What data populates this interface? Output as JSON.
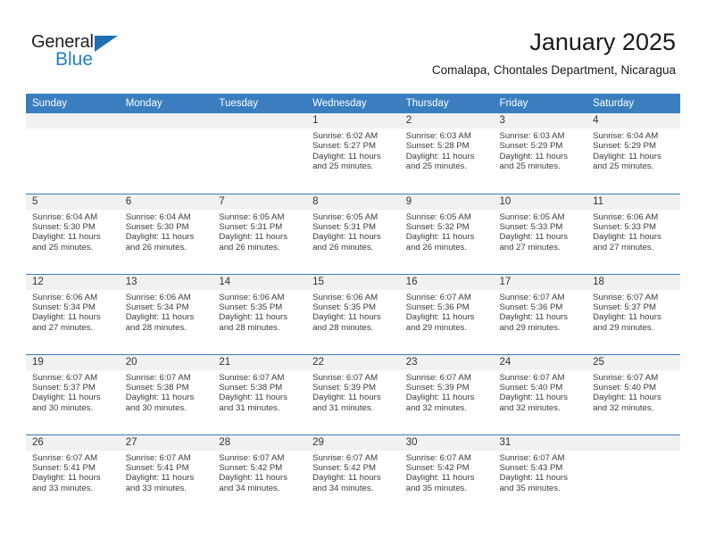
{
  "brand": {
    "name_top": "General",
    "name_bottom": "Blue",
    "triangle_icon": "triangle-icon",
    "color_dark": "#231f20",
    "color_blue": "#1f7fcf"
  },
  "header": {
    "title": "January 2025",
    "subtitle": "Comalapa, Chontales Department, Nicaragua"
  },
  "colors": {
    "header_blue": "#3a7ebf",
    "daynum_band": "#f1f1f1",
    "text": "#3c3c3c"
  },
  "calendar": {
    "weekday_headers": [
      "Sunday",
      "Monday",
      "Tuesday",
      "Wednesday",
      "Thursday",
      "Friday",
      "Saturday"
    ],
    "weeks": [
      [
        {
          "day": "",
          "lines": []
        },
        {
          "day": "",
          "lines": []
        },
        {
          "day": "",
          "lines": []
        },
        {
          "day": "1",
          "lines": [
            "Sunrise: 6:02 AM",
            "Sunset: 5:27 PM",
            "Daylight: 11 hours and 25 minutes."
          ]
        },
        {
          "day": "2",
          "lines": [
            "Sunrise: 6:03 AM",
            "Sunset: 5:28 PM",
            "Daylight: 11 hours and 25 minutes."
          ]
        },
        {
          "day": "3",
          "lines": [
            "Sunrise: 6:03 AM",
            "Sunset: 5:29 PM",
            "Daylight: 11 hours and 25 minutes."
          ]
        },
        {
          "day": "4",
          "lines": [
            "Sunrise: 6:04 AM",
            "Sunset: 5:29 PM",
            "Daylight: 11 hours and 25 minutes."
          ]
        }
      ],
      [
        {
          "day": "5",
          "lines": [
            "Sunrise: 6:04 AM",
            "Sunset: 5:30 PM",
            "Daylight: 11 hours and 25 minutes."
          ]
        },
        {
          "day": "6",
          "lines": [
            "Sunrise: 6:04 AM",
            "Sunset: 5:30 PM",
            "Daylight: 11 hours and 26 minutes."
          ]
        },
        {
          "day": "7",
          "lines": [
            "Sunrise: 6:05 AM",
            "Sunset: 5:31 PM",
            "Daylight: 11 hours and 26 minutes."
          ]
        },
        {
          "day": "8",
          "lines": [
            "Sunrise: 6:05 AM",
            "Sunset: 5:31 PM",
            "Daylight: 11 hours and 26 minutes."
          ]
        },
        {
          "day": "9",
          "lines": [
            "Sunrise: 6:05 AM",
            "Sunset: 5:32 PM",
            "Daylight: 11 hours and 26 minutes."
          ]
        },
        {
          "day": "10",
          "lines": [
            "Sunrise: 6:05 AM",
            "Sunset: 5:33 PM",
            "Daylight: 11 hours and 27 minutes."
          ]
        },
        {
          "day": "11",
          "lines": [
            "Sunrise: 6:06 AM",
            "Sunset: 5:33 PM",
            "Daylight: 11 hours and 27 minutes."
          ]
        }
      ],
      [
        {
          "day": "12",
          "lines": [
            "Sunrise: 6:06 AM",
            "Sunset: 5:34 PM",
            "Daylight: 11 hours and 27 minutes."
          ]
        },
        {
          "day": "13",
          "lines": [
            "Sunrise: 6:06 AM",
            "Sunset: 5:34 PM",
            "Daylight: 11 hours and 28 minutes."
          ]
        },
        {
          "day": "14",
          "lines": [
            "Sunrise: 6:06 AM",
            "Sunset: 5:35 PM",
            "Daylight: 11 hours and 28 minutes."
          ]
        },
        {
          "day": "15",
          "lines": [
            "Sunrise: 6:06 AM",
            "Sunset: 5:35 PM",
            "Daylight: 11 hours and 28 minutes."
          ]
        },
        {
          "day": "16",
          "lines": [
            "Sunrise: 6:07 AM",
            "Sunset: 5:36 PM",
            "Daylight: 11 hours and 29 minutes."
          ]
        },
        {
          "day": "17",
          "lines": [
            "Sunrise: 6:07 AM",
            "Sunset: 5:36 PM",
            "Daylight: 11 hours and 29 minutes."
          ]
        },
        {
          "day": "18",
          "lines": [
            "Sunrise: 6:07 AM",
            "Sunset: 5:37 PM",
            "Daylight: 11 hours and 29 minutes."
          ]
        }
      ],
      [
        {
          "day": "19",
          "lines": [
            "Sunrise: 6:07 AM",
            "Sunset: 5:37 PM",
            "Daylight: 11 hours and 30 minutes."
          ]
        },
        {
          "day": "20",
          "lines": [
            "Sunrise: 6:07 AM",
            "Sunset: 5:38 PM",
            "Daylight: 11 hours and 30 minutes."
          ]
        },
        {
          "day": "21",
          "lines": [
            "Sunrise: 6:07 AM",
            "Sunset: 5:38 PM",
            "Daylight: 11 hours and 31 minutes."
          ]
        },
        {
          "day": "22",
          "lines": [
            "Sunrise: 6:07 AM",
            "Sunset: 5:39 PM",
            "Daylight: 11 hours and 31 minutes."
          ]
        },
        {
          "day": "23",
          "lines": [
            "Sunrise: 6:07 AM",
            "Sunset: 5:39 PM",
            "Daylight: 11 hours and 32 minutes."
          ]
        },
        {
          "day": "24",
          "lines": [
            "Sunrise: 6:07 AM",
            "Sunset: 5:40 PM",
            "Daylight: 11 hours and 32 minutes."
          ]
        },
        {
          "day": "25",
          "lines": [
            "Sunrise: 6:07 AM",
            "Sunset: 5:40 PM",
            "Daylight: 11 hours and 32 minutes."
          ]
        }
      ],
      [
        {
          "day": "26",
          "lines": [
            "Sunrise: 6:07 AM",
            "Sunset: 5:41 PM",
            "Daylight: 11 hours and 33 minutes."
          ]
        },
        {
          "day": "27",
          "lines": [
            "Sunrise: 6:07 AM",
            "Sunset: 5:41 PM",
            "Daylight: 11 hours and 33 minutes."
          ]
        },
        {
          "day": "28",
          "lines": [
            "Sunrise: 6:07 AM",
            "Sunset: 5:42 PM",
            "Daylight: 11 hours and 34 minutes."
          ]
        },
        {
          "day": "29",
          "lines": [
            "Sunrise: 6:07 AM",
            "Sunset: 5:42 PM",
            "Daylight: 11 hours and 34 minutes."
          ]
        },
        {
          "day": "30",
          "lines": [
            "Sunrise: 6:07 AM",
            "Sunset: 5:42 PM",
            "Daylight: 11 hours and 35 minutes."
          ]
        },
        {
          "day": "31",
          "lines": [
            "Sunrise: 6:07 AM",
            "Sunset: 5:43 PM",
            "Daylight: 11 hours and 35 minutes."
          ]
        },
        {
          "day": "",
          "lines": []
        }
      ]
    ]
  }
}
